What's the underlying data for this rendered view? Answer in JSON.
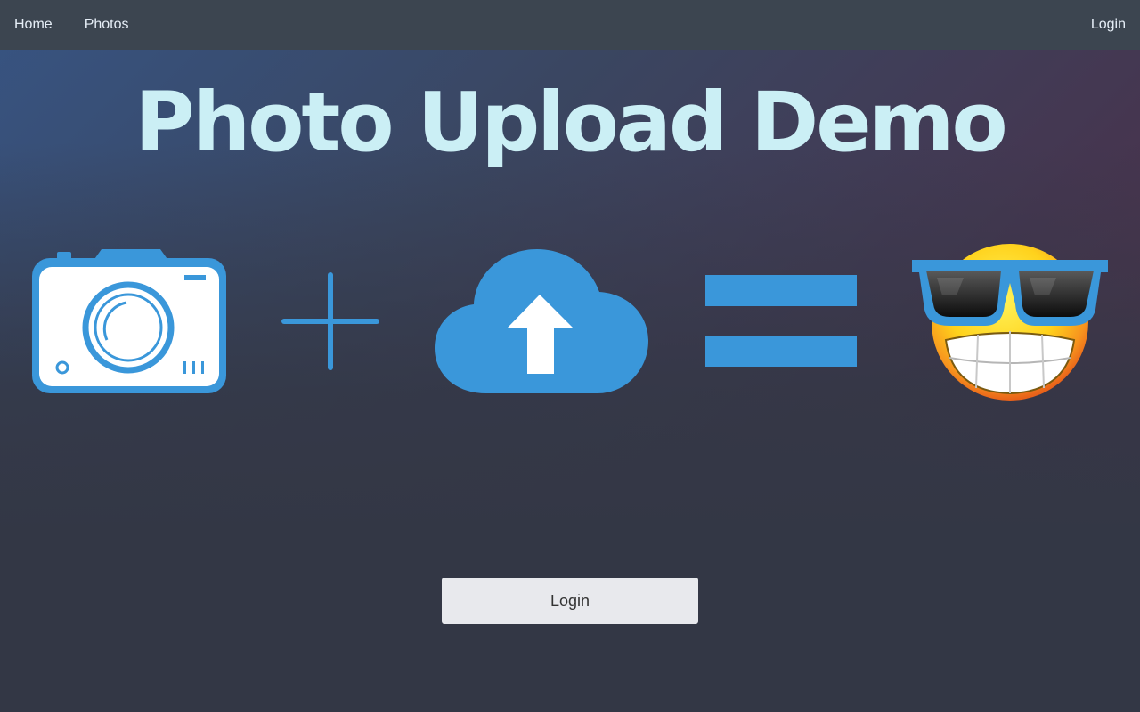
{
  "nav": {
    "home_label": "Home",
    "photos_label": "Photos",
    "login_label": "Login"
  },
  "hero": {
    "title": "Photo Upload Demo"
  },
  "equation": {
    "icons": [
      "camera-icon",
      "plus-icon",
      "cloud-upload-icon",
      "equals-icon",
      "cool-emoji-icon"
    ]
  },
  "main": {
    "login_button_label": "Login"
  },
  "colors": {
    "accent_blue": "#3a97da",
    "title_color": "#cbeff5",
    "navbar_bg": "#3c4550",
    "button_bg": "#e8e9ed"
  }
}
